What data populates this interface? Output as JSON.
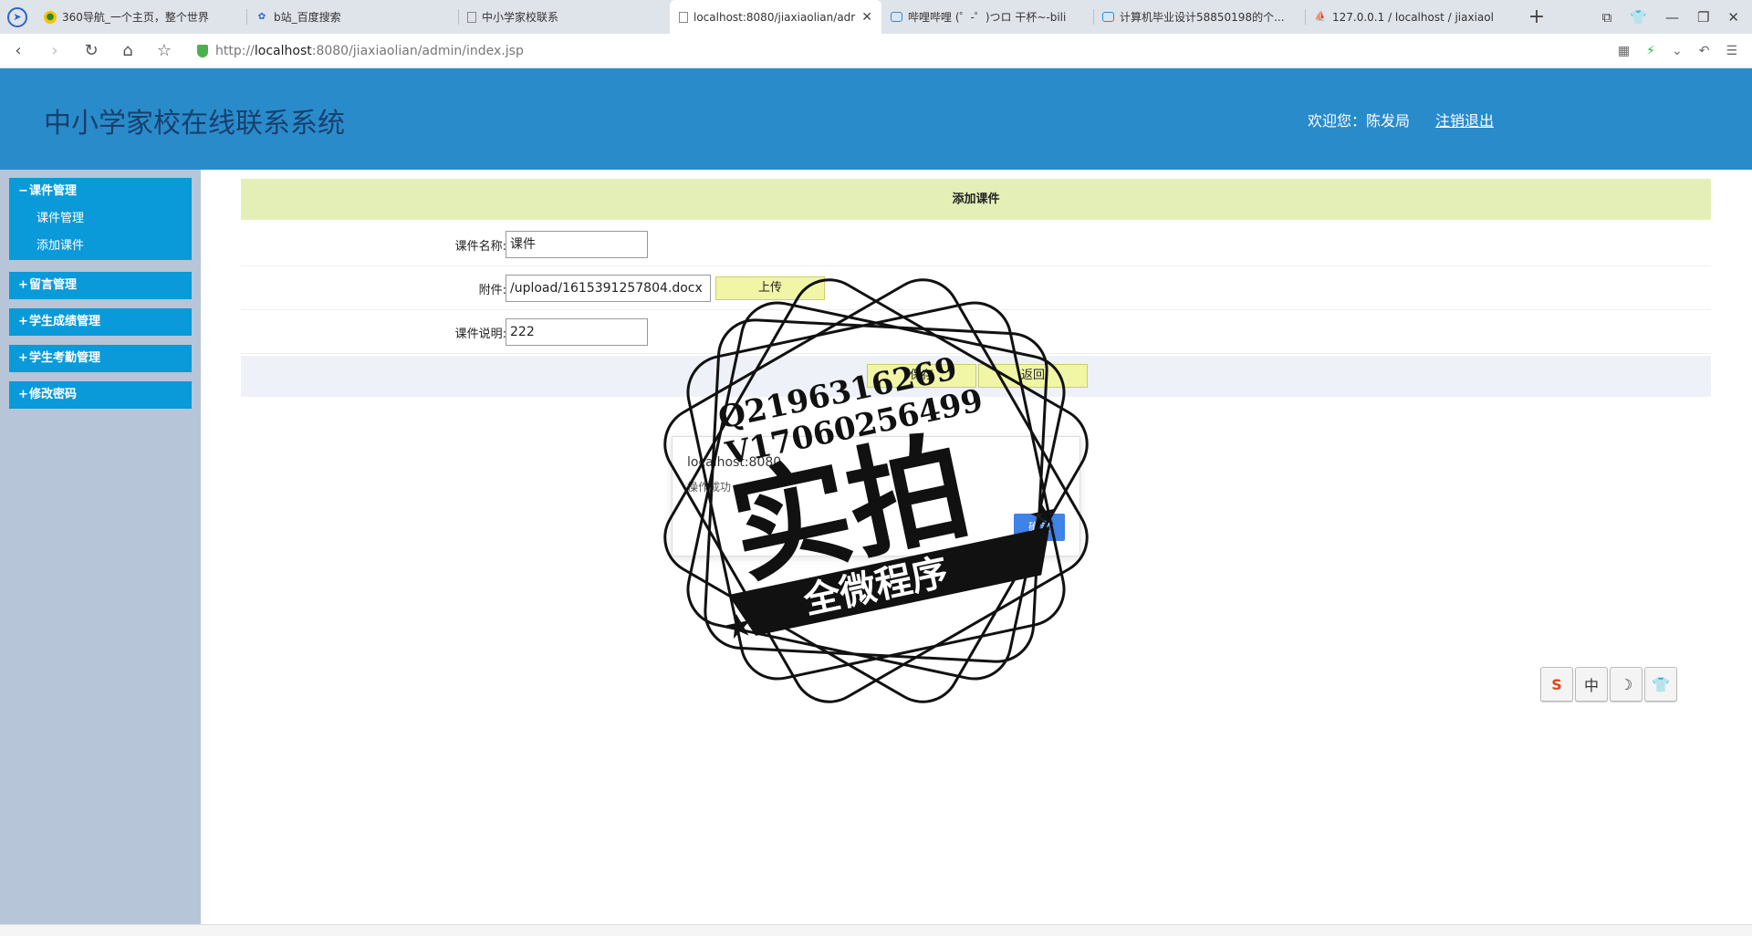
{
  "browser": {
    "tabs": [
      {
        "title": "360导航_一个主页，整个世界",
        "icon": "360-icon"
      },
      {
        "title": "b站_百度搜索",
        "icon": "baidu-icon"
      },
      {
        "title": "中小学家校联系",
        "icon": "page-icon"
      },
      {
        "title": "localhost:8080/jiaxiaolian/adr",
        "icon": "page-icon",
        "active": true
      },
      {
        "title": "哔哩哔哩 (゜-゜)つロ 干杯~-bili",
        "icon": "bilibili-icon"
      },
      {
        "title": "计算机毕业设计58850198的个...",
        "icon": "bilibili-icon"
      },
      {
        "title": "127.0.0.1 / localhost / jiaxiaol",
        "icon": "phpmyadmin-icon"
      }
    ],
    "url_prefix": "http://",
    "url_host": "localhost",
    "url_rest": ":8080/jiaxiaolian/admin/index.jsp"
  },
  "header": {
    "title": "中小学家校在线联系系统",
    "welcome": "欢迎您：陈发局",
    "logout": "注销退出"
  },
  "sidebar": {
    "groups": [
      {
        "label": "课件管理",
        "sign": "−",
        "items": [
          "课件管理",
          "添加课件"
        ]
      },
      {
        "label": "留言管理",
        "sign": "+"
      },
      {
        "label": "学生成绩管理",
        "sign": "+"
      },
      {
        "label": "学生考勤管理",
        "sign": "+"
      },
      {
        "label": "修改密码",
        "sign": "+"
      }
    ]
  },
  "form": {
    "title": "添加课件",
    "name_label": "课件名称:",
    "name_value": "课件",
    "attach_label": "附件:",
    "attach_value": "/upload/1615391257804.docx",
    "upload_btn": "上传",
    "desc_label": "课件说明:",
    "desc_value": "222",
    "save_btn": "保存",
    "back_btn": "返回"
  },
  "dialog": {
    "title": "localhost:8080",
    "message": "操作成功",
    "ok": "确定"
  },
  "watermark": {
    "line1": "Q2196316269",
    "line2": "V17060256499",
    "main": "实拍",
    "banner": "全微程序"
  },
  "ime": {
    "items": [
      "S",
      "中",
      "☽",
      "👕"
    ]
  }
}
